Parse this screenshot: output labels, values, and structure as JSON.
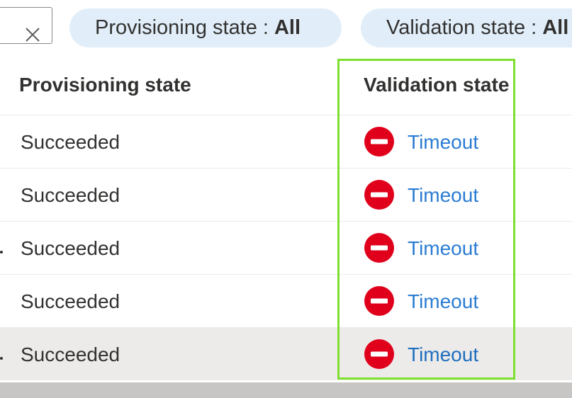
{
  "filters": {
    "clear_icon": "close-icon",
    "provisioning": {
      "label": "Provisioning state",
      "separator": ":",
      "value": "All"
    },
    "validation": {
      "label": "Validation state",
      "separator": ":",
      "value": "All"
    }
  },
  "table": {
    "columns": [
      {
        "label": "Provisioning state"
      },
      {
        "label": "Validation state"
      }
    ],
    "rows": [
      {
        "provisioning": "Succeeded",
        "validation": "Timeout",
        "status_icon": "error-blocked-icon"
      },
      {
        "provisioning": "Succeeded",
        "validation": "Timeout",
        "status_icon": "error-blocked-icon"
      },
      {
        "provisioning": "Succeeded",
        "validation": "Timeout",
        "status_icon": "error-blocked-icon"
      },
      {
        "provisioning": "Succeeded",
        "validation": "Timeout",
        "status_icon": "error-blocked-icon"
      },
      {
        "provisioning": "Succeeded",
        "validation": "Timeout",
        "status_icon": "error-blocked-icon"
      }
    ]
  },
  "colors": {
    "accent": "#2b7cd3",
    "error": "#d13438",
    "pill_background": "#e1eef9",
    "highlight": "#7ee02e"
  }
}
